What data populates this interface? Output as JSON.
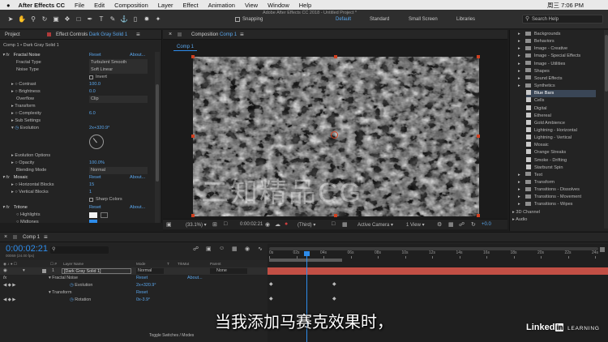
{
  "menubar": {
    "items": [
      "After Effects CC",
      "File",
      "Edit",
      "Composition",
      "Layer",
      "Effect",
      "Animation",
      "View",
      "Window",
      "Help"
    ],
    "clock": "周三 7:06 PM"
  },
  "toolbar": {
    "snapping": "Snapping",
    "title": "Adobe After Effects CC 2018 - Untitled Project *",
    "workspaces": [
      "Default",
      "Standard",
      "Small Screen",
      "Libraries"
    ],
    "search_placeholder": "Search Help"
  },
  "effect_controls": {
    "tab_project": "Project",
    "tab_label": "Effect Controls",
    "tab_layer": "Dark Gray Solid 1",
    "breadcrumb": "Comp 1 • Dark Gray Solid 1",
    "reset": "Reset",
    "about": "About...",
    "fractal_noise": "Fractal Noise",
    "fractal_type": "Fractal Type",
    "fractal_type_value": "Turbulent Smooth",
    "noise_type": "Noise Type",
    "noise_type_value": "Soft Linear",
    "invert": "Invert",
    "contrast": "Contrast",
    "contrast_value": "100.0",
    "brightness": "Brightness",
    "brightness_value": "0.0",
    "overflow": "Overflow",
    "overflow_value": "Clip",
    "transform": "Transform",
    "complexity": "Complexity",
    "complexity_value": "6.0",
    "sub_settings": "Sub Settings",
    "evolution": "Evolution",
    "evolution_value": "2x+320.9°",
    "evolution_options": "Evolution Options",
    "opacity": "Opacity",
    "opacity_value": "100.0%",
    "blending_mode": "Blending Mode",
    "blending_mode_value": "Normal",
    "mosaic": "Mosaic",
    "horizontal_blocks": "Horizontal Blocks",
    "horizontal_blocks_value": "15",
    "vertical_blocks": "Vertical Blocks",
    "vertical_blocks_value": "1",
    "sharp_colors": "Sharp Colors",
    "tritone": "Tritone",
    "highlights": "Highlights",
    "midtones": "Midtones"
  },
  "composition": {
    "panel_label": "Composition",
    "comp_name": "Comp 1",
    "tab": "Comp 1",
    "watermark": "二知精品CG",
    "footer": {
      "zoom": "(33.1%)",
      "timecode": "0:00:02:21",
      "resolution": "(Third)",
      "camera": "Active Camera",
      "views": "1 View",
      "exposure": "+0.0"
    }
  },
  "effects_presets": {
    "categories": [
      {
        "label": "Backgrounds",
        "kind": "folder"
      },
      {
        "label": "Behaviors",
        "kind": "folder"
      },
      {
        "label": "Image - Creative",
        "kind": "folder"
      },
      {
        "label": "Image - Special Effects",
        "kind": "folder"
      },
      {
        "label": "Image - Utilities",
        "kind": "folder"
      },
      {
        "label": "Shapes",
        "kind": "folder"
      },
      {
        "label": "Sound Effects",
        "kind": "folder"
      },
      {
        "label": "Synthetics",
        "kind": "folder"
      },
      {
        "label": "Blue Bars",
        "kind": "preset"
      },
      {
        "label": "Cells",
        "kind": "preset"
      },
      {
        "label": "Digital",
        "kind": "preset"
      },
      {
        "label": "Ethereal",
        "kind": "preset"
      },
      {
        "label": "Gold Ambience",
        "kind": "preset"
      },
      {
        "label": "Lightning - Horizontal",
        "kind": "preset"
      },
      {
        "label": "Lightning - Vertical",
        "kind": "preset"
      },
      {
        "label": "Mosaic",
        "kind": "preset"
      },
      {
        "label": "Orange Streaks",
        "kind": "preset"
      },
      {
        "label": "Smoke - Drifting",
        "kind": "preset"
      },
      {
        "label": "Starburst Spin",
        "kind": "preset"
      },
      {
        "label": "Text",
        "kind": "folder"
      },
      {
        "label": "Transform",
        "kind": "folder"
      },
      {
        "label": "Transitions - Dissolves",
        "kind": "folder"
      },
      {
        "label": "Transitions - Movement",
        "kind": "folder"
      },
      {
        "label": "Transitions - Wipes",
        "kind": "folder"
      },
      {
        "label": "3D Channel",
        "kind": "root"
      },
      {
        "label": "Audio",
        "kind": "root"
      }
    ]
  },
  "timeline": {
    "tab": "Comp 1",
    "timecode": "0:00:02:21",
    "frame_info": "00069 (24.00 fps)",
    "search_placeholder": "",
    "columns": {
      "layer_name": "Layer Name",
      "mode": "Mode",
      "t": "T",
      "trkmat": "TrkMat",
      "parent": "Parent"
    },
    "ruler": [
      "0s",
      "02s",
      "04s",
      "06s",
      "08s",
      "10s",
      "12s",
      "14s",
      "16s",
      "18s",
      "20s",
      "22s",
      "24s"
    ],
    "layer": {
      "number": "1",
      "name": "[Dark Gray Solid 1]",
      "mode": "Normal",
      "parent": "None"
    },
    "props": {
      "fractal_noise": "Fractal Noise",
      "reset": "Reset",
      "about": "About...",
      "evolution": "Evolution",
      "evolution_value": "2x+320.9°",
      "transform": "Transform",
      "rotation": "Rotation",
      "rotation_value": "0x-3.9°"
    },
    "footer": "Toggle Switches / Modes"
  },
  "subtitle": "当我添加马赛克效果时，",
  "branding": {
    "linked": "Linked",
    "in": "in",
    "learning": "LEARNING"
  },
  "colors": {
    "accent": "#2d8ceb",
    "value_blue": "#5aa7ee",
    "timecode": "#2d8ceb",
    "work_area": "#c24f45"
  }
}
